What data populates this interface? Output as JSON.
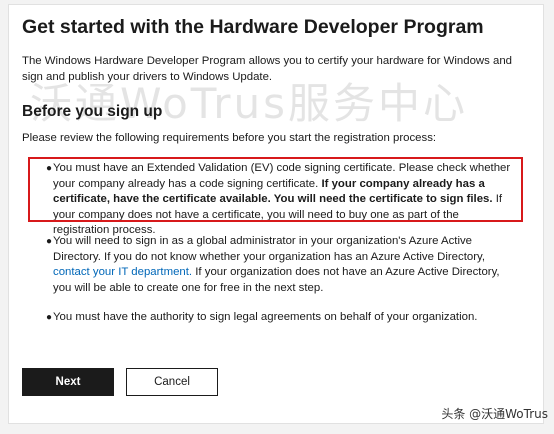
{
  "page": {
    "title": "Get started with the Hardware Developer Program",
    "intro": "The Windows Hardware Developer Program allows you to certify your hardware for Windows and sign and publish your drivers to Windows Update.",
    "subheading": "Before you sign up",
    "review_text": "Please review the following requirements before you start the registration process:"
  },
  "requirements": [
    {
      "part1": "You must have an Extended Validation (EV) code signing certificate. Please check whether your company already has a code signing certificate. ",
      "bold": "If your company already has a certificate, have the certificate available. You will need the certificate to sign files.",
      "part2": " If your company does not have a certificate, you will need to buy one as part of the registration process."
    },
    {
      "part1": "You will need to sign in as a global administrator in your organization's Azure Active Directory. If you do not know whether your organization has an Azure Active Directory, ",
      "link": "contact your IT department.",
      "part2": " If your organization does not have an Azure Active Directory, you will be able to create one for free in the next step."
    },
    {
      "part1": "You must have the authority to sign legal agreements on behalf of your organization."
    }
  ],
  "buttons": {
    "next": "Next",
    "cancel": "Cancel"
  },
  "watermark": "沃通WoTrus服务中心",
  "brand": "头条 @沃通WoTrus",
  "colors": {
    "highlight_border": "#d7191b",
    "link": "#0067b8",
    "primary_button": "#1b1b1b"
  }
}
